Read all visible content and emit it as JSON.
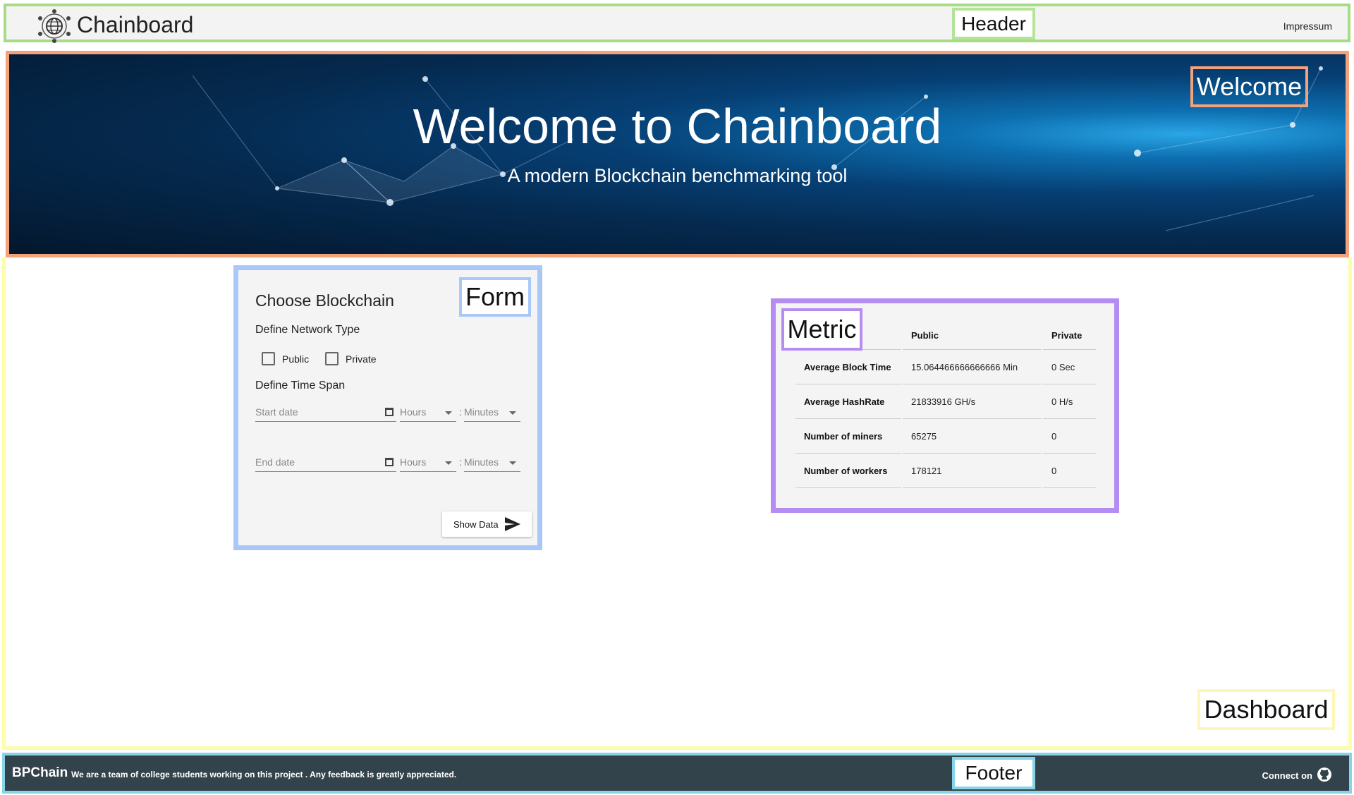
{
  "annotations": {
    "header": "Header",
    "welcome": "Welcome",
    "form": "Form",
    "metric": "Metric",
    "dashboard": "Dashboard",
    "footer": "Footer"
  },
  "header": {
    "brand": "Chainboard",
    "logo_icon": "blockchain-globe-icon",
    "impressum": "Impressum"
  },
  "welcome": {
    "title": "Welcome to Chainboard",
    "subtitle": "A modern Blockchain benchmarking tool"
  },
  "form": {
    "title": "Choose Blockchain",
    "network_type_label": "Define Network Type",
    "network_options": [
      "Public",
      "Private"
    ],
    "time_span_label": "Define Time Span",
    "start_date_placeholder": "Start date",
    "end_date_placeholder": "End date",
    "hours_placeholder": "Hours",
    "minutes_placeholder": "Minutes",
    "colon": ":",
    "show_button": "Show Data",
    "send_icon": "send-icon",
    "calendar_icon": "calendar-icon"
  },
  "metric": {
    "columns": [
      "",
      "Public",
      "Private"
    ],
    "rows": [
      {
        "label": "Average Block Time",
        "public": "15.064466666666666 Min",
        "private": "0 Sec"
      },
      {
        "label": "Average HashRate",
        "public": "21833916 GH/s",
        "private": "0 H/s"
      },
      {
        "label": "Number of miners",
        "public": "65275",
        "private": "0"
      },
      {
        "label": "Number of workers",
        "public": "178121",
        "private": "0"
      }
    ]
  },
  "footer": {
    "brand": "BPChain",
    "text": "We are a team of college students working on this project . Any feedback is greatly appreciated.",
    "connect": "Connect on",
    "github_icon": "github-icon"
  },
  "colors": {
    "header_bg": "#f3f3f3",
    "footer_bg": "#33434b",
    "form_bg": "#f4f4f4",
    "header_outline": "#a6dc84",
    "welcome_outline": "#f4a27a",
    "form_outline": "#a9c8f7",
    "metric_outline": "#b48cf2",
    "dashboard_outline": "#fdfca8",
    "footer_outline": "#87d3e8"
  }
}
